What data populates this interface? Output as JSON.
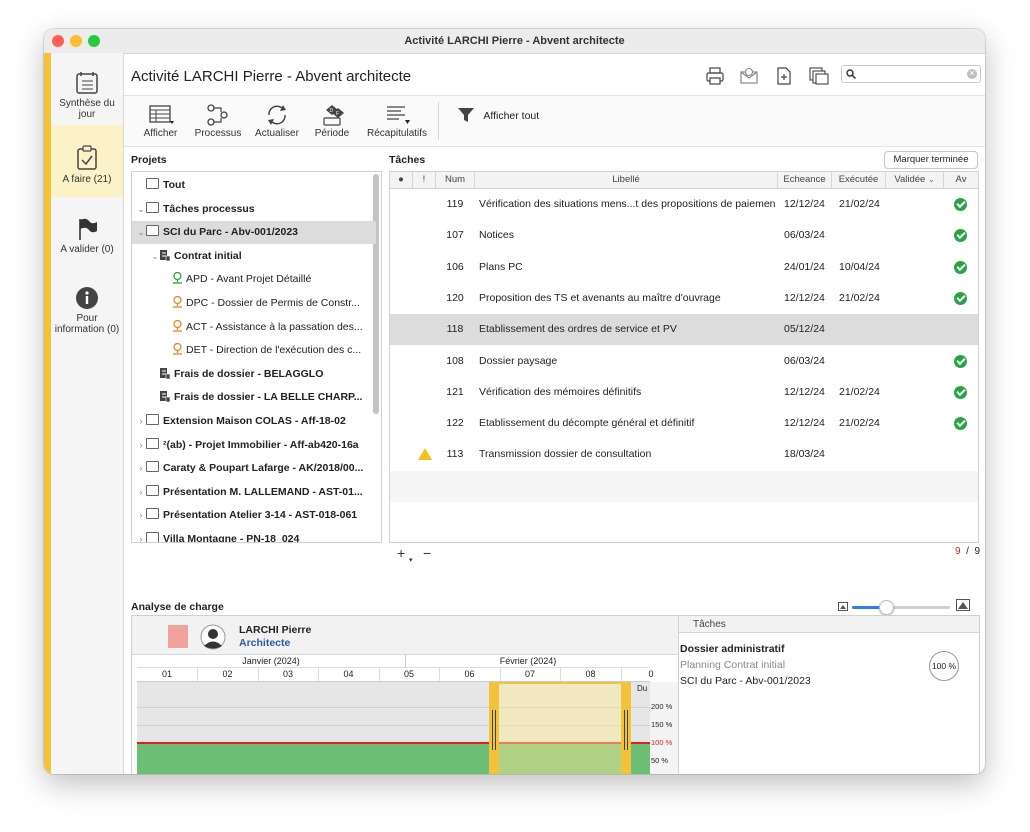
{
  "window": {
    "title": "Activité LARCHI Pierre - Abvent architecte"
  },
  "sidebar": {
    "items": [
      {
        "label": "Synthèse du jour",
        "icon": "calendar-list-icon"
      },
      {
        "label": "A faire (21)",
        "icon": "clipboard-check-icon",
        "active": true
      },
      {
        "label": "A valider (0)",
        "icon": "flag-icon"
      },
      {
        "label": "Pour information (0)",
        "icon": "info-icon"
      }
    ]
  },
  "header": {
    "title": "Activité LARCHI Pierre - Abvent architecte",
    "search_placeholder": ""
  },
  "toolbar": {
    "afficher": "Afficher",
    "processus": "Processus",
    "actualiser": "Actualiser",
    "periode": "Période",
    "recapitulatifs": "Récapitulatifs",
    "afficher_tout": "Afficher tout"
  },
  "projects": {
    "label": "Projets",
    "rows": [
      {
        "text": "Tout",
        "bold": true,
        "type": "folder",
        "indent": 0,
        "chev": ""
      },
      {
        "text": "Tâches processus",
        "bold": true,
        "type": "folder",
        "indent": 0,
        "chev": "⌄"
      },
      {
        "text": "SCI du Parc - Abv-001/2023",
        "bold": true,
        "type": "folder",
        "indent": 1,
        "chev": "⌄",
        "selected": true
      },
      {
        "text": "Contrat initial",
        "bold": true,
        "type": "doc",
        "indent": 2,
        "chev": "⌄"
      },
      {
        "text": "APD - Avant Projet Détaillé",
        "bold": false,
        "type": "pin-green",
        "indent": 3,
        "chev": ""
      },
      {
        "text": "DPC - Dossier de Permis de Constr...",
        "bold": false,
        "type": "pin-orange",
        "indent": 3,
        "chev": ""
      },
      {
        "text": "ACT - Assistance à la passation des...",
        "bold": false,
        "type": "pin-orange",
        "indent": 3,
        "chev": ""
      },
      {
        "text": "DET - Direction de l'exécution des c...",
        "bold": false,
        "type": "pin-orange",
        "indent": 3,
        "chev": ""
      },
      {
        "text": "Frais de dossier - BELAGGLO",
        "bold": true,
        "type": "doc",
        "indent": 2,
        "chev": ""
      },
      {
        "text": "Frais de dossier - LA BELLE CHARP...",
        "bold": true,
        "type": "doc",
        "indent": 2,
        "chev": ""
      },
      {
        "text": "Extension Maison COLAS - Aff-18-02",
        "bold": true,
        "type": "folder",
        "indent": 1,
        "chev": "›"
      },
      {
        "text": "²(ab) - Projet Immobilier - Aff-ab420-16a",
        "bold": true,
        "type": "folder",
        "indent": 1,
        "chev": "›"
      },
      {
        "text": "Caraty & Poupart Lafarge - AK/2018/00...",
        "bold": true,
        "type": "folder",
        "indent": 1,
        "chev": "›"
      },
      {
        "text": "Présentation M. LALLEMAND - AST-01...",
        "bold": true,
        "type": "folder",
        "indent": 1,
        "chev": "›"
      },
      {
        "text": "Présentation Atelier 3-14 - AST-018-061",
        "bold": true,
        "type": "folder",
        "indent": 1,
        "chev": "›"
      },
      {
        "text": "Villa Montagne - PN-18_024",
        "bold": true,
        "type": "folder",
        "indent": 1,
        "chev": "›"
      }
    ]
  },
  "tasks": {
    "label": "Tâches",
    "mark_done": "Marquer terminée",
    "columns": {
      "dot": "●",
      "excl": "!",
      "num": "Num",
      "libelle": "Libellé",
      "echeance": "Echeance",
      "executee": "Exécutée",
      "validee": "Validée",
      "av": "Av"
    },
    "rows": [
      {
        "num": "119",
        "libelle": "Vérification des situations mens...t des propositions de paiement",
        "echeance": "12/12/24",
        "executee": "21/02/24",
        "done": true,
        "warn": false,
        "selected": false
      },
      {
        "num": "107",
        "libelle": "Notices",
        "echeance": "06/03/24",
        "executee": "",
        "done": true,
        "warn": false,
        "selected": false
      },
      {
        "num": "106",
        "libelle": "Plans PC",
        "echeance": "24/01/24",
        "executee": "10/04/24",
        "done": true,
        "warn": false,
        "selected": false
      },
      {
        "num": "120",
        "libelle": "Proposition des TS et avenants au maître d'ouvrage",
        "echeance": "12/12/24",
        "executee": "21/02/24",
        "done": true,
        "warn": false,
        "selected": false
      },
      {
        "num": "118",
        "libelle": "Etablissement des ordres de service et PV",
        "echeance": "05/12/24",
        "executee": "",
        "done": false,
        "warn": false,
        "selected": true
      },
      {
        "num": "108",
        "libelle": "Dossier paysage",
        "echeance": "06/03/24",
        "executee": "",
        "done": true,
        "warn": false,
        "selected": false
      },
      {
        "num": "121",
        "libelle": "Vérification des mémoires définitifs",
        "echeance": "12/12/24",
        "executee": "21/02/24",
        "done": true,
        "warn": false,
        "selected": false
      },
      {
        "num": "122",
        "libelle": "Etablissement du décompte général et définitif",
        "echeance": "12/12/24",
        "executee": "21/02/24",
        "done": true,
        "warn": false,
        "selected": false
      },
      {
        "num": "113",
        "libelle": "Transmission dossier de consultation",
        "echeance": "18/03/24",
        "executee": "",
        "done": false,
        "warn": true,
        "selected": false
      }
    ],
    "count_shown": "9",
    "count_sep": "/",
    "count_total": "9"
  },
  "analyse": {
    "label": "Analyse de charge",
    "person_name": "LARCHI Pierre",
    "person_role": "Architecte",
    "month1": "Janvier (2024)",
    "month2": "Février (2024)",
    "weeks": [
      "01",
      "02",
      "03",
      "04",
      "05",
      "06",
      "07",
      "08",
      "0"
    ],
    "du_label": "Du",
    "pct_200": "200 %",
    "pct_150": "150 %",
    "pct_100": "100 %",
    "pct_50": "50 %"
  },
  "details": {
    "tab": "Tâches",
    "title": "Dossier administratif",
    "subtitle": "Planning Contrat initial",
    "project": "SCI du Parc - Abv-001/2023",
    "progress": "100 %"
  },
  "colors": {
    "accent": "#f1c33a",
    "done": "#27a545",
    "warn": "#f2c21b",
    "load": "#6dbe77",
    "limit": "#e02020"
  }
}
